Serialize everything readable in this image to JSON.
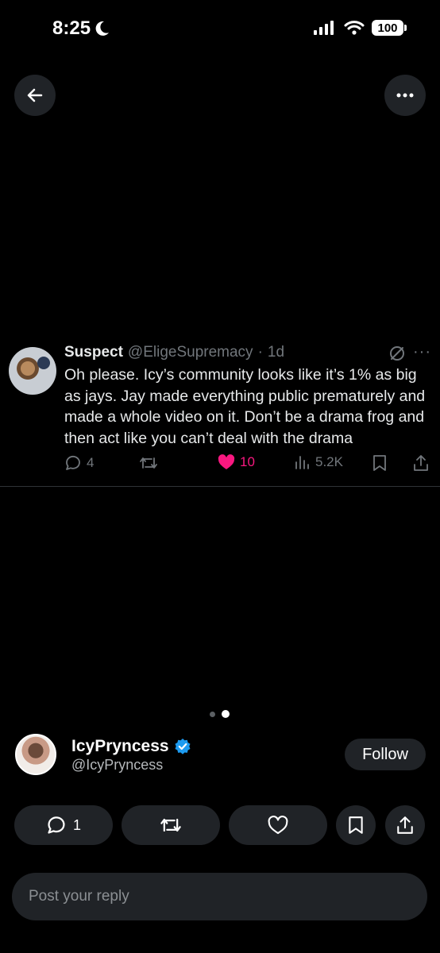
{
  "status_bar": {
    "time": "8:25",
    "battery": "100",
    "icons": [
      "moon-icon",
      "signal-icon",
      "wifi-icon",
      "battery-icon"
    ]
  },
  "top_bar": {
    "back_icon": "arrow-left-icon",
    "more_icon": "ellipsis-icon"
  },
  "tweet": {
    "name": "Suspect",
    "handle": "@EligeSupremacy",
    "separator": "·",
    "time": "1d",
    "text": "Oh please. Icy’s community looks like it’s 1% as big as jays. Jay made everything public prematurely and made a whole video on it. Don’t be a drama frog and then act like you can’t deal with the drama",
    "actions": {
      "replies": "4",
      "likes": "10",
      "views": "5.2K"
    },
    "like_color": "#f91880"
  },
  "carousel": {
    "pages": 2,
    "active": 2
  },
  "author": {
    "name": "IcyPryncess",
    "handle": "@IcyPryncess",
    "verified_color": "#1d9bf0",
    "follow_label": "Follow"
  },
  "bottom_actions": {
    "reply_count": "1"
  },
  "reply_box": {
    "placeholder": "Post your reply"
  }
}
